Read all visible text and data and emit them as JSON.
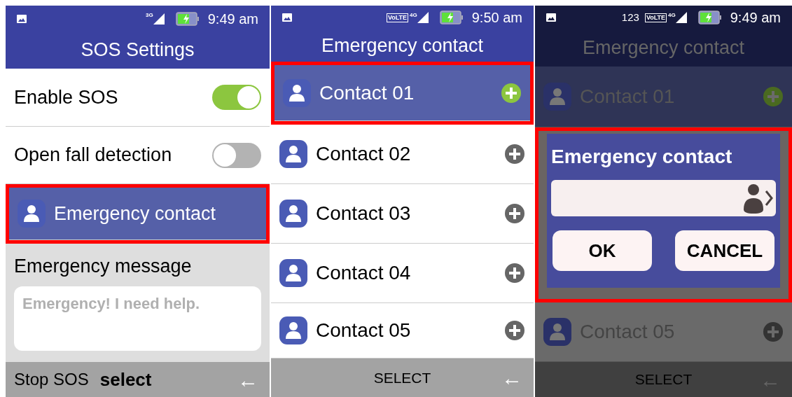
{
  "screens": [
    {
      "kind": "settings",
      "dimmed": false,
      "status": {
        "network": "3G",
        "time": "9:49 am"
      },
      "title": "SOS Settings",
      "items": [
        {
          "kind": "toggle",
          "label": "Enable SOS",
          "on": true,
          "selected": false,
          "outlined": false
        },
        {
          "kind": "toggle",
          "label": "Open fall detection",
          "on": false,
          "selected": false,
          "outlined": false
        },
        {
          "kind": "link",
          "label": "Emergency contact",
          "selected": true,
          "outlined": true
        }
      ],
      "message": {
        "label": "Emergency message",
        "placeholder": "Emergency! I need help."
      },
      "softkeys": {
        "left": "Stop SOS",
        "center": "select",
        "right": "←"
      }
    },
    {
      "kind": "contacts",
      "dimmed": false,
      "status": {
        "network": "4G",
        "volte": "VoLTE",
        "time": "9:50 am"
      },
      "title": "Emergency contact",
      "items": [
        {
          "label": "Contact 01",
          "selected": true,
          "outlined": true
        },
        {
          "label": "Contact 02",
          "selected": false,
          "outlined": false
        },
        {
          "label": "Contact 03",
          "selected": false,
          "outlined": false
        },
        {
          "label": "Contact 04",
          "selected": false,
          "outlined": false
        },
        {
          "label": "Contact 05",
          "selected": false,
          "outlined": false
        }
      ],
      "softkeys": {
        "center": "SELECT",
        "right": "←"
      }
    },
    {
      "kind": "contacts",
      "dimmed": true,
      "status": {
        "extra": "123",
        "network": "4G",
        "volte": "VoLTE",
        "time": "9:49 am"
      },
      "title": "Emergency contact",
      "items": [
        {
          "label": "Contact 01",
          "selected": true,
          "outlined": false
        },
        {
          "label": "Contact 05",
          "selected": false,
          "outlined": false
        }
      ],
      "dialog": {
        "title": "Emergency contact",
        "buttons": [
          "OK",
          "CANCEL"
        ],
        "outlined": true
      },
      "softkeys": {
        "center": "SELECT",
        "right": "←"
      }
    }
  ]
}
